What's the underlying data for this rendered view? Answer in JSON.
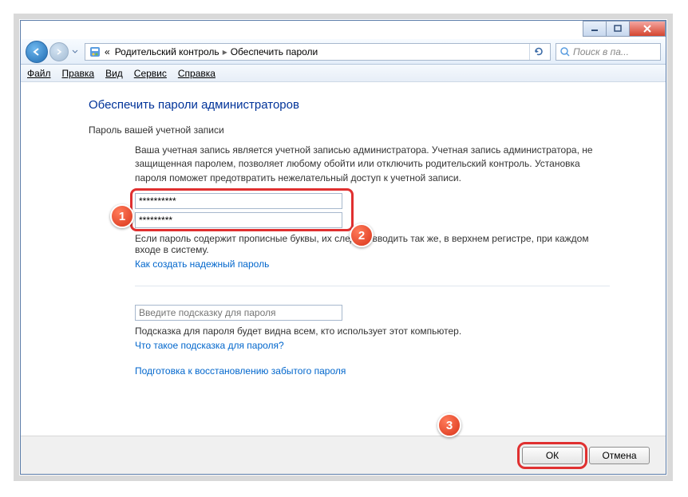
{
  "titlebar": {
    "min": "minimize",
    "max": "maximize",
    "close": "close"
  },
  "nav": {
    "breadcrumb_prefix": "«",
    "crumb1": "Родительский контроль",
    "crumb2": "Обеспечить пароли",
    "search_placeholder": "Поиск в па..."
  },
  "menu": {
    "file": "Файл",
    "edit": "Правка",
    "view": "Вид",
    "tools": "Сервис",
    "help": "Справка"
  },
  "page": {
    "heading": "Обеспечить пароли администраторов",
    "section": "Пароль вашей учетной записи",
    "body": "Ваша учетная запись является учетной записью администратора. Учетная запись администратора, не защищенная паролем, позволяет любому обойти или отключить родительский контроль. Установка пароля поможет предотвратить нежелательный доступ к учетной записи.",
    "pwd1": "**********",
    "pwd2": "*********",
    "note": "Если пароль содержит прописные буквы, их следует вводить так же, в верхнем регистре, при каждом входе в систему.",
    "link1": "Как создать надежный пароль",
    "hint_placeholder": "Введите подсказку для пароля",
    "hint_note": "Подсказка для пароля будет видна всем, кто использует этот компьютер.",
    "link2": "Что такое подсказка для пароля?",
    "link3": "Подготовка к восстановлению забытого пароля"
  },
  "footer": {
    "ok": "ОК",
    "cancel": "Отмена"
  },
  "markers": {
    "m1": "1",
    "m2": "2",
    "m3": "3"
  }
}
